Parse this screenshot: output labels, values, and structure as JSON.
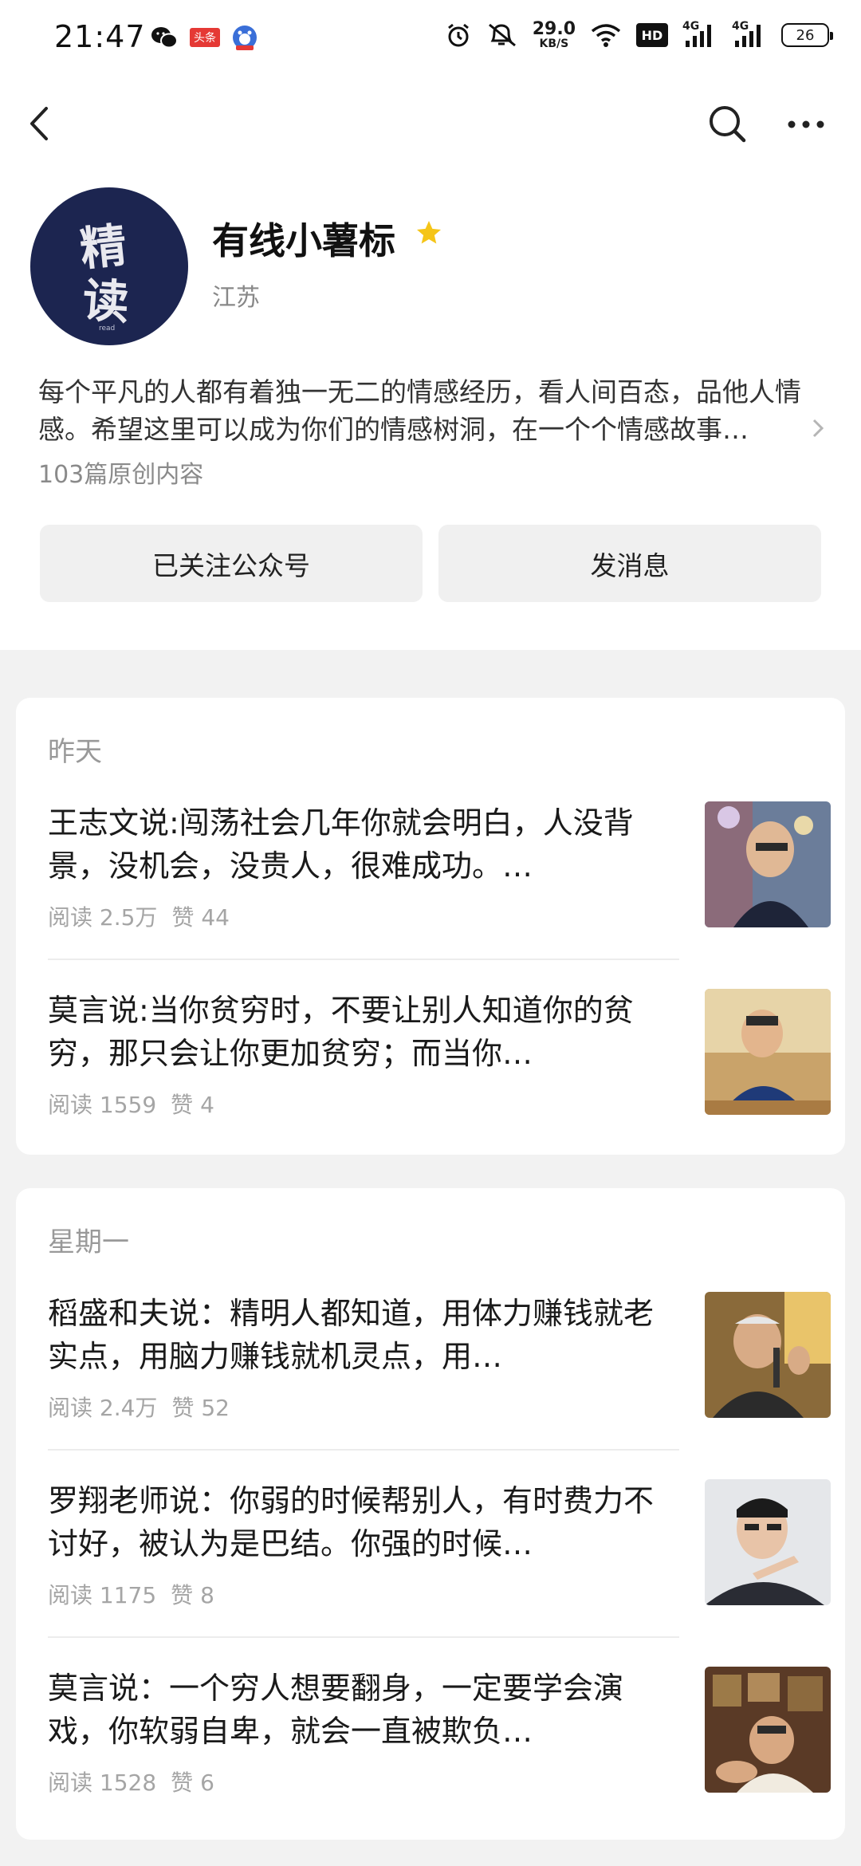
{
  "status_bar": {
    "time": "21:47",
    "apps": [
      "wechat-icon",
      "toutiao-icon",
      "baidu-icon"
    ],
    "toutiao_label": "头条",
    "net_speed_value": "29.0",
    "net_speed_unit": "KB/S",
    "hd_label": "HD",
    "signal1_label": "4G",
    "signal2_label": "4G",
    "battery": "26"
  },
  "nav": {
    "back_icon": "back-arrow-icon",
    "search_icon": "search-icon",
    "more_icon": "more-icon"
  },
  "profile": {
    "avatar_chars": [
      "精",
      "读"
    ],
    "avatar_small": "read",
    "name": "有线小薯标",
    "region": "江苏",
    "description": "每个平凡的人都有着独一无二的情感经历，看人间百态，品他人情感。希望这里可以成为你们的情感树洞，在一个个情感故事…",
    "article_count": "103篇原创内容",
    "follow_button": "已关注公众号",
    "message_button": "发消息",
    "star_color": "#f5c518"
  },
  "groups": [
    {
      "day": "昨天",
      "articles": [
        {
          "title": "王志文说:闯荡社会几年你就会明白，人没背景，没机会，没贵人，很难成功。…",
          "reads": "阅读 2.5万",
          "likes": "赞 44"
        },
        {
          "title": "莫言说:当你贫穷时，不要让别人知道你的贫穷，那只会让你更加贫穷；而当你…",
          "reads": "阅读 1559",
          "likes": "赞 4"
        }
      ]
    },
    {
      "day": "星期一",
      "articles": [
        {
          "title": "稻盛和夫说：精明人都知道，用体力赚钱就老实点，用脑力赚钱就机灵点，用…",
          "reads": "阅读 2.4万",
          "likes": "赞 52"
        },
        {
          "title": "罗翔老师说：你弱的时候帮别人，有时费力不讨好，被认为是巴结。你强的时候…",
          "reads": "阅读 1175",
          "likes": "赞 8"
        },
        {
          "title": "莫言说：一个穷人想要翻身，一定要学会演戏，你软弱自卑，就会一直被欺负…",
          "reads": "阅读 1528",
          "likes": "赞 6"
        }
      ]
    }
  ]
}
